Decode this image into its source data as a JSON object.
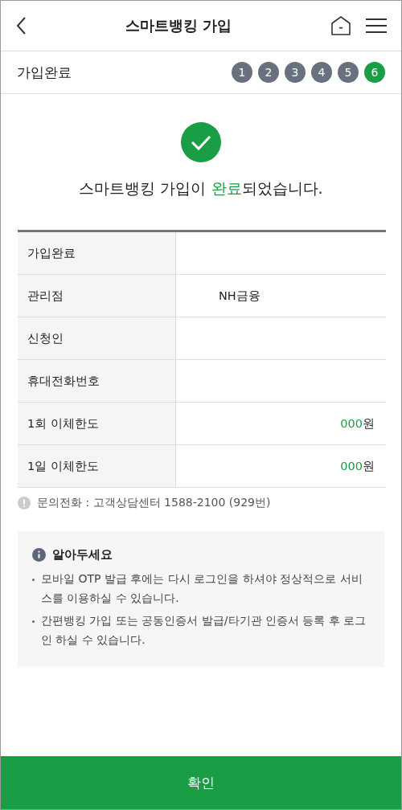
{
  "header": {
    "title": "스마트뱅킹 가입"
  },
  "progress": {
    "label": "가입완료",
    "steps": [
      {
        "label": "1",
        "selected": false
      },
      {
        "label": "2",
        "selected": false
      },
      {
        "label": "3",
        "selected": false
      },
      {
        "label": "4",
        "selected": false
      },
      {
        "label": "5",
        "selected": false
      },
      {
        "label": "6",
        "selected": true
      }
    ]
  },
  "message": [
    {
      "text": "스마트뱅킹 가입이 ",
      "highlight": false
    },
    {
      "text": "완료",
      "highlight": true
    },
    {
      "text": "되었습니다.",
      "highlight": false
    }
  ],
  "table": {
    "rows": [
      {
        "label": "가입완료",
        "kind": "text"
      },
      {
        "label": "관리점",
        "kind": "text",
        "value": "NH금융"
      },
      {
        "label": "신청인",
        "kind": "text"
      },
      {
        "label": "휴대전화번호",
        "kind": "text"
      },
      {
        "label": "1회 이체한도",
        "kind": "amount",
        "amount": "000",
        "unit": "원"
      },
      {
        "label": "1일 이체한도",
        "kind": "amount",
        "amount": "000",
        "unit": "원"
      }
    ]
  },
  "contact": "문의전화 : 고객상담센터 1588-2100 (929번)",
  "notice": {
    "title": "알아두세요",
    "items": [
      "모바일 OTP 발급 후에는 다시 로그인을 하셔야 정상적으로 서비스를 이용하실 수 있습니다.",
      "간편뱅킹 가입 또는 공동인증서 발급/타기관 인증서 등록 후 로그인 하실 수 있습니다."
    ]
  },
  "confirm_button": "확인"
}
